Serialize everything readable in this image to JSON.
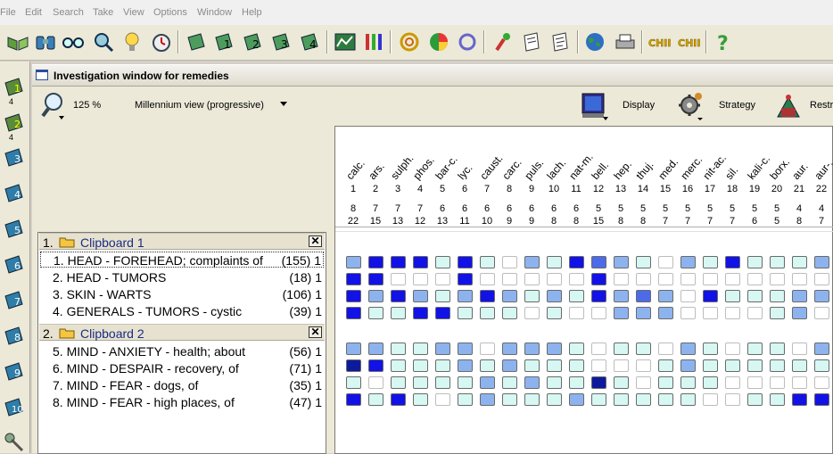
{
  "menu": [
    "File",
    "Edit",
    "Search",
    "Take",
    "View",
    "Options",
    "Window",
    "Help"
  ],
  "toolbar_icons": [
    "open-book-icon",
    "binoculars-icon",
    "glasses-icon",
    "magnifier-icon",
    "lightbulb-icon",
    "stopwatch-icon",
    "clipboard-icon",
    "clipboard-1-icon",
    "clipboard-2-icon",
    "clipboard-3-icon",
    "clipboard-4-icon",
    "graph-icon",
    "test-tubes-icon",
    "ring-icon",
    "pie-icon",
    "circle-arrows-icon",
    "brush-icon",
    "scroll-icon",
    "scroll-2-icon",
    "globe-icon",
    "printer-icon",
    "chip-icon",
    "chip-2-icon",
    "help-icon"
  ],
  "left_tools": {
    "counts": [
      "4",
      "4"
    ],
    "icons": [
      "clipboard-1-icon",
      "clipboard-2-icon",
      "clipboard-3-icon",
      "clipboard-4-icon",
      "clipboard-5-icon",
      "clipboard-6-icon",
      "clipboard-7-icon",
      "clipboard-8-icon",
      "clipboard-9-icon",
      "clipboard-10-icon",
      "wrench-icon"
    ]
  },
  "window": {
    "title": "Investigation window for remedies",
    "zoom": "125 %",
    "view_mode": "Millennium view (progressive)",
    "display_label": "Display",
    "strategy_label": "Strategy",
    "restrict_label": "Restr"
  },
  "clipboards": [
    {
      "number": "1.",
      "title": "Clipboard 1",
      "close": "✕",
      "rubrics": [
        {
          "text": "1. HEAD - FOREHEAD; complaints of",
          "count": "(155) 1",
          "selected": true
        },
        {
          "text": "2. HEAD - TUMORS",
          "count": "(18) 1"
        },
        {
          "text": "3. SKIN - WARTS",
          "count": "(106) 1"
        },
        {
          "text": "4. GENERALS - TUMORS - cystic",
          "count": "(39) 1"
        }
      ]
    },
    {
      "number": "2.",
      "title": "Clipboard 2",
      "close": "✕",
      "rubrics": [
        {
          "text": "5. MIND - ANXIETY - health; about",
          "count": "(56) 1"
        },
        {
          "text": "6. MIND - DESPAIR - recovery, of",
          "count": "(71) 1"
        },
        {
          "text": "7. MIND - FEAR - dogs, of",
          "count": "(35) 1"
        },
        {
          "text": "8. MIND - FEAR - high places, of",
          "count": "(47) 1"
        }
      ]
    }
  ],
  "remedies": [
    {
      "name": "calc.",
      "rank": "1",
      "score": "8",
      "rubrics": "22"
    },
    {
      "name": "ars.",
      "rank": "2",
      "score": "7",
      "rubrics": "15"
    },
    {
      "name": "sulph.",
      "rank": "3",
      "score": "7",
      "rubrics": "13"
    },
    {
      "name": "phos.",
      "rank": "4",
      "score": "7",
      "rubrics": "12"
    },
    {
      "name": "bar-c.",
      "rank": "5",
      "score": "6",
      "rubrics": "13"
    },
    {
      "name": "lyc.",
      "rank": "6",
      "score": "6",
      "rubrics": "11"
    },
    {
      "name": "caust.",
      "rank": "7",
      "score": "6",
      "rubrics": "10"
    },
    {
      "name": "carc.",
      "rank": "8",
      "score": "6",
      "rubrics": "9"
    },
    {
      "name": "puls.",
      "rank": "9",
      "score": "6",
      "rubrics": "9"
    },
    {
      "name": "lach.",
      "rank": "10",
      "score": "6",
      "rubrics": "8"
    },
    {
      "name": "nat-m.",
      "rank": "11",
      "score": "6",
      "rubrics": "8"
    },
    {
      "name": "bell.",
      "rank": "12",
      "score": "5",
      "rubrics": "15"
    },
    {
      "name": "hep.",
      "rank": "13",
      "score": "5",
      "rubrics": "8"
    },
    {
      "name": "thuj.",
      "rank": "14",
      "score": "5",
      "rubrics": "8"
    },
    {
      "name": "med.",
      "rank": "15",
      "score": "5",
      "rubrics": "7"
    },
    {
      "name": "merc.",
      "rank": "16",
      "score": "5",
      "rubrics": "7"
    },
    {
      "name": "nit-ac.",
      "rank": "17",
      "score": "5",
      "rubrics": "7"
    },
    {
      "name": "sil.",
      "rank": "18",
      "score": "5",
      "rubrics": "7"
    },
    {
      "name": "kali-c.",
      "rank": "19",
      "score": "5",
      "rubrics": "6"
    },
    {
      "name": "borx.",
      "rank": "20",
      "score": "5",
      "rubrics": "5"
    },
    {
      "name": "aur.",
      "rank": "21",
      "score": "4",
      "rubrics": "8"
    },
    {
      "name": "aur-...",
      "rank": "22",
      "score": "4",
      "rubrics": "7"
    }
  ],
  "grades": [
    [
      2,
      4,
      4,
      4,
      1,
      4,
      1,
      0,
      2,
      1,
      4,
      3,
      2,
      1,
      0,
      2,
      1,
      4,
      1,
      1,
      1,
      2
    ],
    [
      4,
      4,
      0,
      0,
      0,
      4,
      0,
      0,
      0,
      0,
      0,
      4,
      0,
      0,
      0,
      0,
      0,
      0,
      0,
      0,
      0,
      0
    ],
    [
      4,
      2,
      4,
      2,
      1,
      2,
      4,
      2,
      1,
      2,
      1,
      4,
      2,
      3,
      2,
      0,
      4,
      1,
      1,
      1,
      2,
      2
    ],
    [
      4,
      1,
      1,
      4,
      4,
      1,
      1,
      1,
      0,
      1,
      0,
      0,
      2,
      2,
      2,
      0,
      0,
      0,
      0,
      1,
      2,
      0
    ],
    [
      2,
      2,
      1,
      1,
      2,
      2,
      0,
      2,
      2,
      2,
      1,
      0,
      1,
      1,
      0,
      2,
      1,
      0,
      1,
      1,
      0,
      2
    ],
    [
      5,
      4,
      1,
      1,
      1,
      2,
      1,
      2,
      1,
      1,
      1,
      0,
      0,
      0,
      1,
      2,
      1,
      1,
      1,
      1,
      1,
      1
    ],
    [
      1,
      0,
      1,
      1,
      1,
      1,
      2,
      1,
      2,
      1,
      1,
      5,
      1,
      0,
      1,
      1,
      1,
      0,
      0,
      0,
      0,
      0
    ],
    [
      4,
      1,
      4,
      1,
      0,
      1,
      2,
      1,
      1,
      1,
      2,
      1,
      1,
      1,
      1,
      1,
      0,
      0,
      1,
      1,
      4,
      4
    ]
  ],
  "grade_colors": {
    "0": "#ffffff",
    "1": "#d6f7f2",
    "2": "#8db3ef",
    "3": "#4d6be9",
    "4": "#1212e6",
    "5": "#0e1a9c"
  }
}
